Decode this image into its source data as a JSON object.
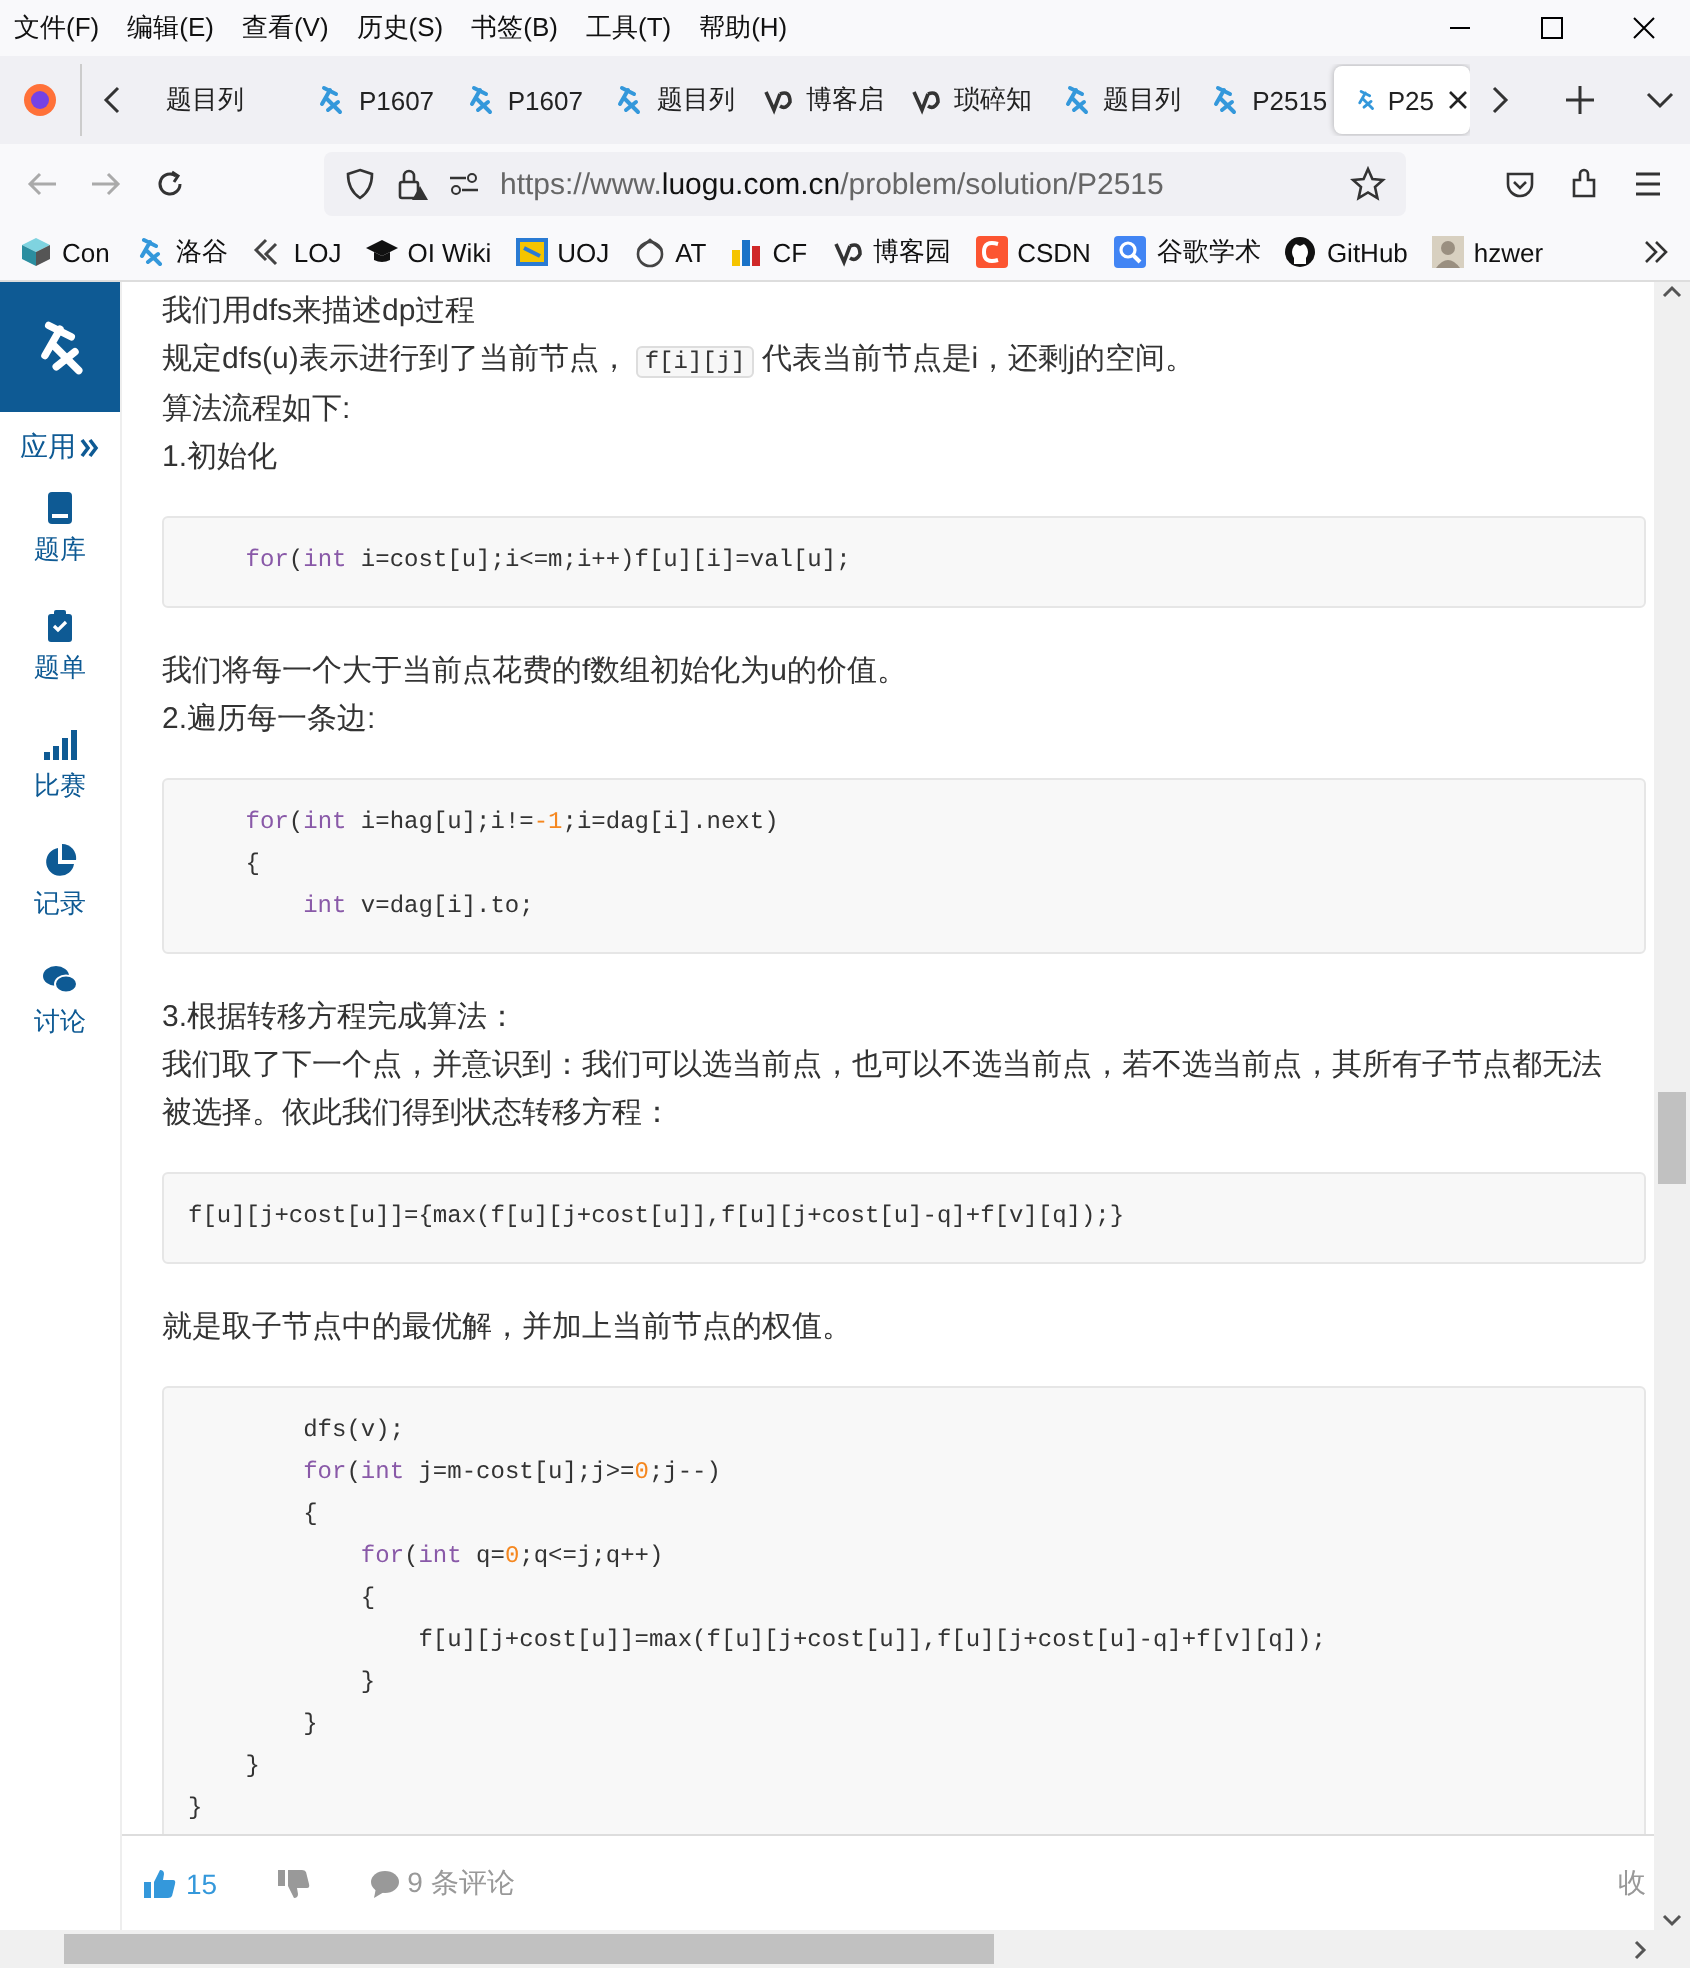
{
  "menu": [
    "文件(F)",
    "编辑(E)",
    "查看(V)",
    "历史(S)",
    "书签(B)",
    "工具(T)",
    "帮助(H)"
  ],
  "tabs": [
    {
      "label": "题目列",
      "kind": "plain",
      "selected": false
    },
    {
      "label": "P1607",
      "kind": "luogu",
      "selected": false
    },
    {
      "label": "P1607",
      "kind": "luogu",
      "selected": false
    },
    {
      "label": "题目列",
      "kind": "luogu",
      "selected": false
    },
    {
      "label": "博客启",
      "kind": "blog",
      "selected": false
    },
    {
      "label": "琐碎知",
      "kind": "blog",
      "selected": false
    },
    {
      "label": "题目列",
      "kind": "luogu",
      "selected": false
    },
    {
      "label": "P2515",
      "kind": "luogu",
      "selected": false
    },
    {
      "label": "P25",
      "kind": "luogu",
      "selected": true
    }
  ],
  "address": {
    "host_prefix": "https://www.",
    "host": "luogu.com.cn",
    "path": "/problem/solution/P2515"
  },
  "bookmarks": [
    {
      "label": "Con"
    },
    {
      "label": "洛谷"
    },
    {
      "label": "LOJ"
    },
    {
      "label": "OI Wiki"
    },
    {
      "label": "UOJ"
    },
    {
      "label": "AT"
    },
    {
      "label": "CF"
    },
    {
      "label": "博客园"
    },
    {
      "label": "CSDN"
    },
    {
      "label": "谷歌学术"
    },
    {
      "label": "GitHub"
    },
    {
      "label": "hzwer"
    }
  ],
  "sidebar": {
    "apps": "应用",
    "items": [
      {
        "label": "题库"
      },
      {
        "label": "题单"
      },
      {
        "label": "比赛"
      },
      {
        "label": "记录"
      },
      {
        "label": "讨论"
      }
    ]
  },
  "article": [
    {
      "kind": "paragraph",
      "parts": [
        {
          "kind": "text",
          "text": "我们用dfs来描述dp过程"
        }
      ]
    },
    {
      "kind": "paragraph",
      "parts": [
        {
          "kind": "text",
          "text": "规定dfs(u)表示进行到了当前节点，"
        },
        {
          "kind": "code",
          "text": "f[i][j]"
        },
        {
          "kind": "text",
          "text": "代表当前节点是i，还剩j的空间。"
        }
      ]
    },
    {
      "kind": "paragraph",
      "parts": [
        {
          "kind": "text",
          "text": "算法流程如下:"
        }
      ]
    },
    {
      "kind": "paragraph",
      "parts": [
        {
          "kind": "text",
          "text": "1.初始化"
        }
      ]
    },
    {
      "kind": "code",
      "lines": [
        [
          {
            "kind": "keyword",
            "text": "    for"
          },
          {
            "kind": "plain",
            "text": "("
          },
          {
            "kind": "keyword",
            "text": "int"
          },
          {
            "kind": "plain",
            "text": " i=cost[u];i<=m;i++)f[u][i]=val[u];"
          }
        ]
      ]
    },
    {
      "kind": "paragraph",
      "parts": [
        {
          "kind": "text",
          "text": "我们将每一个大于当前点花费的f数组初始化为u的价值。"
        }
      ]
    },
    {
      "kind": "paragraph",
      "parts": [
        {
          "kind": "text",
          "text": "2.遍历每一条边:"
        }
      ]
    },
    {
      "kind": "code",
      "lines": [
        [
          {
            "kind": "keyword",
            "text": "    for"
          },
          {
            "kind": "plain",
            "text": "("
          },
          {
            "kind": "keyword",
            "text": "int"
          },
          {
            "kind": "plain",
            "text": " i=hag[u];i!="
          },
          {
            "kind": "number",
            "text": "-1"
          },
          {
            "kind": "plain",
            "text": ";i=dag[i].next)"
          }
        ],
        [
          {
            "kind": "plain",
            "text": "    {"
          }
        ],
        [
          {
            "kind": "keyword",
            "text": "        int"
          },
          {
            "kind": "plain",
            "text": " v=dag[i].to;"
          }
        ]
      ]
    },
    {
      "kind": "paragraph",
      "parts": [
        {
          "kind": "text",
          "text": "3.根据转移方程完成算法："
        }
      ]
    },
    {
      "kind": "paragraph",
      "parts": [
        {
          "kind": "text",
          "text": "我们取了下一个点，并意识到：我们可以选当前点，也可以不选当前点，若不选当前点，其所有子节点都无法被选择。依此我们得到状态转移方程："
        }
      ]
    },
    {
      "kind": "code",
      "lines": [
        [
          {
            "kind": "plain",
            "text": "f[u][j+cost[u]]={max(f[u][j+cost[u]],f[u][j+cost[u]-q]+f[v][q]);}"
          }
        ]
      ]
    },
    {
      "kind": "paragraph",
      "parts": [
        {
          "kind": "text",
          "text": "就是取子节点中的最优解，并加上当前节点的权值。"
        }
      ]
    },
    {
      "kind": "code",
      "lines": [
        [
          {
            "kind": "plain",
            "text": "        dfs(v);"
          }
        ],
        [
          {
            "kind": "keyword",
            "text": "        for"
          },
          {
            "kind": "plain",
            "text": "("
          },
          {
            "kind": "keyword",
            "text": "int"
          },
          {
            "kind": "plain",
            "text": " j=m-cost[u];j>="
          },
          {
            "kind": "number",
            "text": "0"
          },
          {
            "kind": "plain",
            "text": ";j--)"
          }
        ],
        [
          {
            "kind": "plain",
            "text": "        {"
          }
        ],
        [
          {
            "kind": "keyword",
            "text": "            for"
          },
          {
            "kind": "plain",
            "text": "("
          },
          {
            "kind": "keyword",
            "text": "int"
          },
          {
            "kind": "plain",
            "text": " q="
          },
          {
            "kind": "number",
            "text": "0"
          },
          {
            "kind": "plain",
            "text": ";q<=j;q++)"
          }
        ],
        [
          {
            "kind": "plain",
            "text": "            {"
          }
        ],
        [
          {
            "kind": "plain",
            "text": "                f[u][j+cost[u]]=max(f[u][j+cost[u]],f[u][j+cost[u]-q]+f[v][q]);"
          }
        ],
        [
          {
            "kind": "plain",
            "text": "            }"
          }
        ],
        [
          {
            "kind": "plain",
            "text": "        }"
          }
        ],
        [
          {
            "kind": "plain",
            "text": "    }"
          }
        ],
        [
          {
            "kind": "plain",
            "text": "}"
          }
        ]
      ]
    }
  ],
  "footer": {
    "likes": "15",
    "comments": "9 条评论",
    "collapse": "收"
  }
}
